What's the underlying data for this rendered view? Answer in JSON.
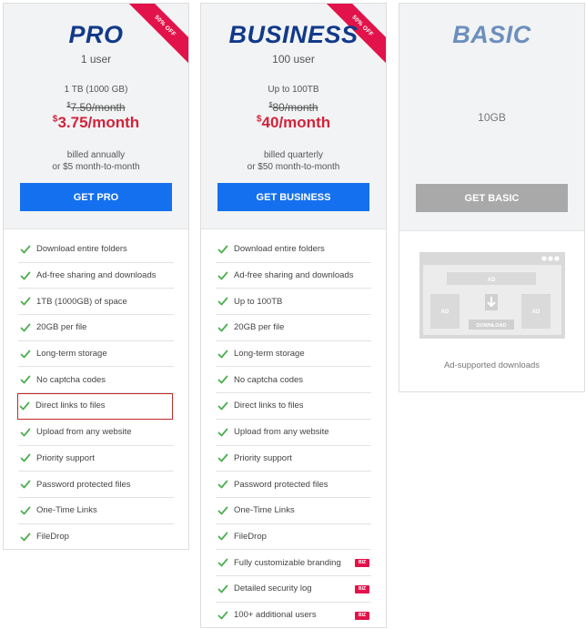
{
  "plans": {
    "pro": {
      "name": "PRO",
      "users": "1 user",
      "storage": "1 TB (1000 GB)",
      "old_price_currency": "$",
      "old_price": "7.50/month",
      "new_price_currency": "$",
      "new_price": "3.75/month",
      "billing_line1": "billed annually",
      "billing_line2": "or $5 month-to-month",
      "cta_label": "GET PRO",
      "ribbon": "50% OFF",
      "features": [
        "Download entire folders",
        "Ad-free sharing and downloads",
        "1TB (1000GB) of space",
        "20GB per file",
        "Long-term storage",
        "No captcha codes",
        "Direct links to files",
        "Upload from any website",
        "Priority support",
        "Password protected files",
        "One-Time Links",
        "FileDrop"
      ]
    },
    "business": {
      "name": "BUSINESS",
      "users": "100 user",
      "storage": "Up to 100TB",
      "old_price_currency": "$",
      "old_price": "80/month",
      "new_price_currency": "$",
      "new_price": "40/month",
      "billing_line1": "billed quarterly",
      "billing_line2": "or $50 month-to-month",
      "cta_label": "GET BUSINESS",
      "ribbon": "50% OFF",
      "biz_badge": "BIZ",
      "features": [
        "Download entire folders",
        "Ad-free sharing and downloads",
        "Up to 100TB",
        "20GB per file",
        "Long-term storage",
        "No captcha codes",
        "Direct links to files",
        "Upload from any website",
        "Priority support",
        "Password protected files",
        "One-Time Links",
        "FileDrop",
        "Fully customizable branding",
        "Detailed security log",
        "100+ additional users"
      ]
    },
    "basic": {
      "name": "BASIC",
      "storage": "10GB",
      "cta_label": "GET BASIC",
      "ad_label_top": "AD",
      "ad_label_left": "AD",
      "ad_label_right": "AD",
      "download_label": "DOWNLOAD",
      "caption": "Ad-supported downloads"
    }
  },
  "colors": {
    "primary_button": "#1570ef",
    "price_red": "#d0243c",
    "ribbon": "#e2134a",
    "check_green": "#4caf50",
    "disabled_button": "#a9a9a9",
    "plan_title": "#123a8a"
  },
  "icons": {
    "check": "check-icon",
    "download": "download-icon"
  }
}
